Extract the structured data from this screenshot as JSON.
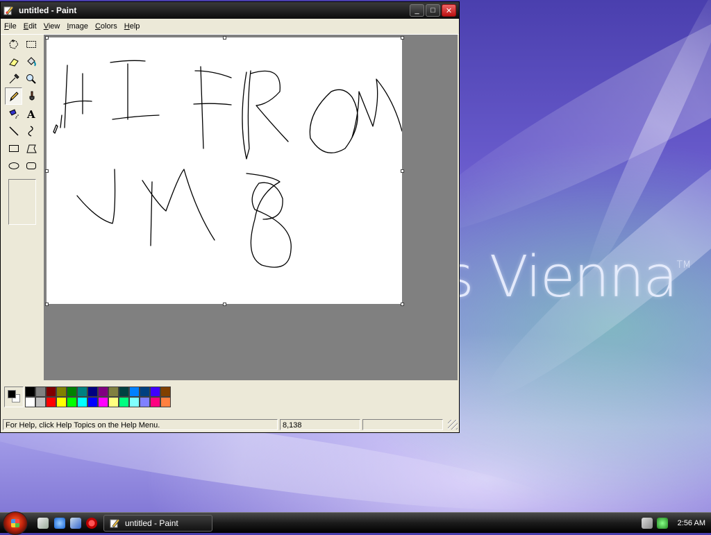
{
  "window": {
    "title": "untitled - Paint",
    "menu": [
      {
        "label": "File",
        "u": "F",
        "rest": "ile"
      },
      {
        "label": "Edit",
        "u": "E",
        "rest": "dit"
      },
      {
        "label": "View",
        "u": "V",
        "rest": "iew"
      },
      {
        "label": "Image",
        "u": "I",
        "rest": "mage"
      },
      {
        "label": "Colors",
        "u": "C",
        "rest": "olors"
      },
      {
        "label": "Help",
        "u": "H",
        "rest": "elp"
      }
    ],
    "buttons": {
      "minimize": "_",
      "maximize": "□",
      "close": "✕"
    }
  },
  "tools": [
    "free-form-select",
    "rectangle-select",
    "eraser",
    "fill-with-color",
    "pick-color",
    "magnifier",
    "pencil",
    "brush",
    "airbrush",
    "text",
    "line",
    "curve",
    "rectangle",
    "polygon",
    "ellipse",
    "rounded-rectangle"
  ],
  "selected_tool": "pencil",
  "palette": {
    "foreground": "#000000",
    "background": "#ffffff",
    "colors": [
      "#000000",
      "#808080",
      "#800000",
      "#808000",
      "#008000",
      "#008080",
      "#000080",
      "#800080",
      "#808040",
      "#004040",
      "#0080ff",
      "#004080",
      "#4000ff",
      "#804000",
      "#ffffff",
      "#c0c0c0",
      "#ff0000",
      "#ffff00",
      "#00ff00",
      "#00ffff",
      "#0000ff",
      "#ff00ff",
      "#ffff80",
      "#00ff80",
      "#80ffff",
      "#8080ff",
      "#ff0080",
      "#ff8040"
    ]
  },
  "status": {
    "help": "For Help, click Help Topics on the Help Menu.",
    "coords": "8,138",
    "size": ""
  },
  "desktop": {
    "brand": "s Vienna",
    "tm": "TM"
  },
  "taskbar": {
    "task_label": "untitled - Paint",
    "clock": "2:56 AM"
  }
}
